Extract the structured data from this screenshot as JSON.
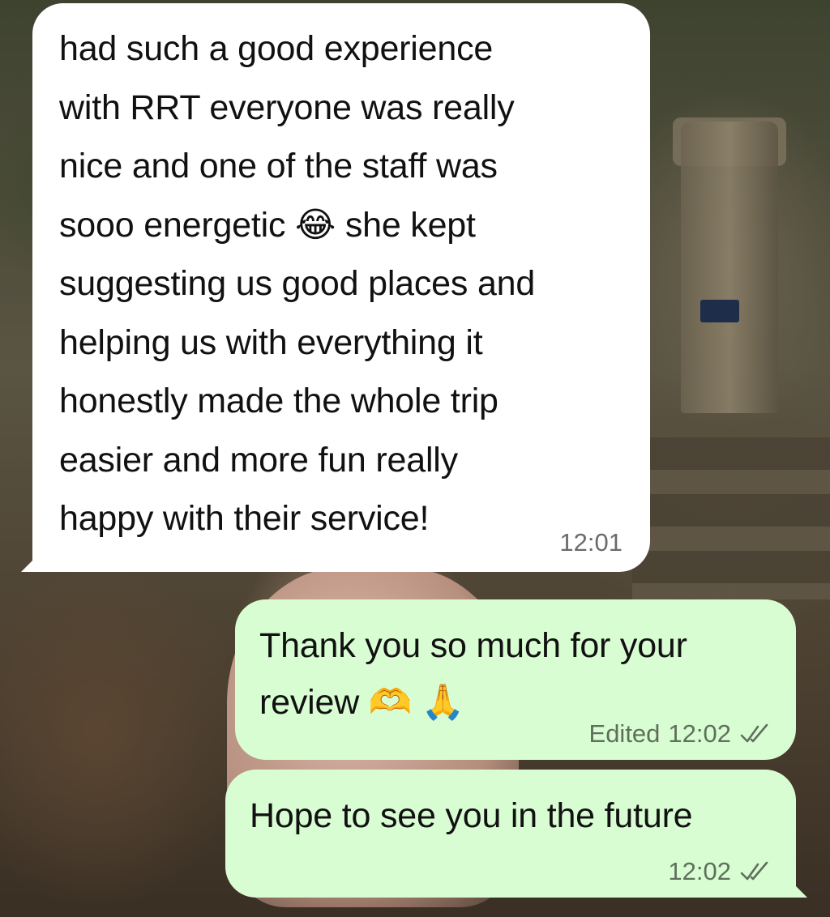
{
  "chat": {
    "messages": [
      {
        "direction": "incoming",
        "text": "had such a good experience\nwith RRT everyone was really\nnice and one of the staff was\nsooo energetic 😂 she kept\nsuggesting us good places and\nhelping us with everything it\nhonestly made the whole trip\neasier and more fun really\nhappy with their service!",
        "time": "12:01"
      },
      {
        "direction": "outgoing",
        "text": "Thank you so much for your\nreview 🫶 🙏",
        "edited_label": "Edited",
        "time": "12:02",
        "status_icon": "double-check-icon"
      },
      {
        "direction": "outgoing",
        "text": "Hope to see you in the future",
        "time": "12:02",
        "status_icon": "double-check-icon"
      }
    ]
  },
  "colors": {
    "incoming_bubble": "#ffffff",
    "outgoing_bubble": "#d9fdd3",
    "timestamp": "#6b6b6b"
  }
}
